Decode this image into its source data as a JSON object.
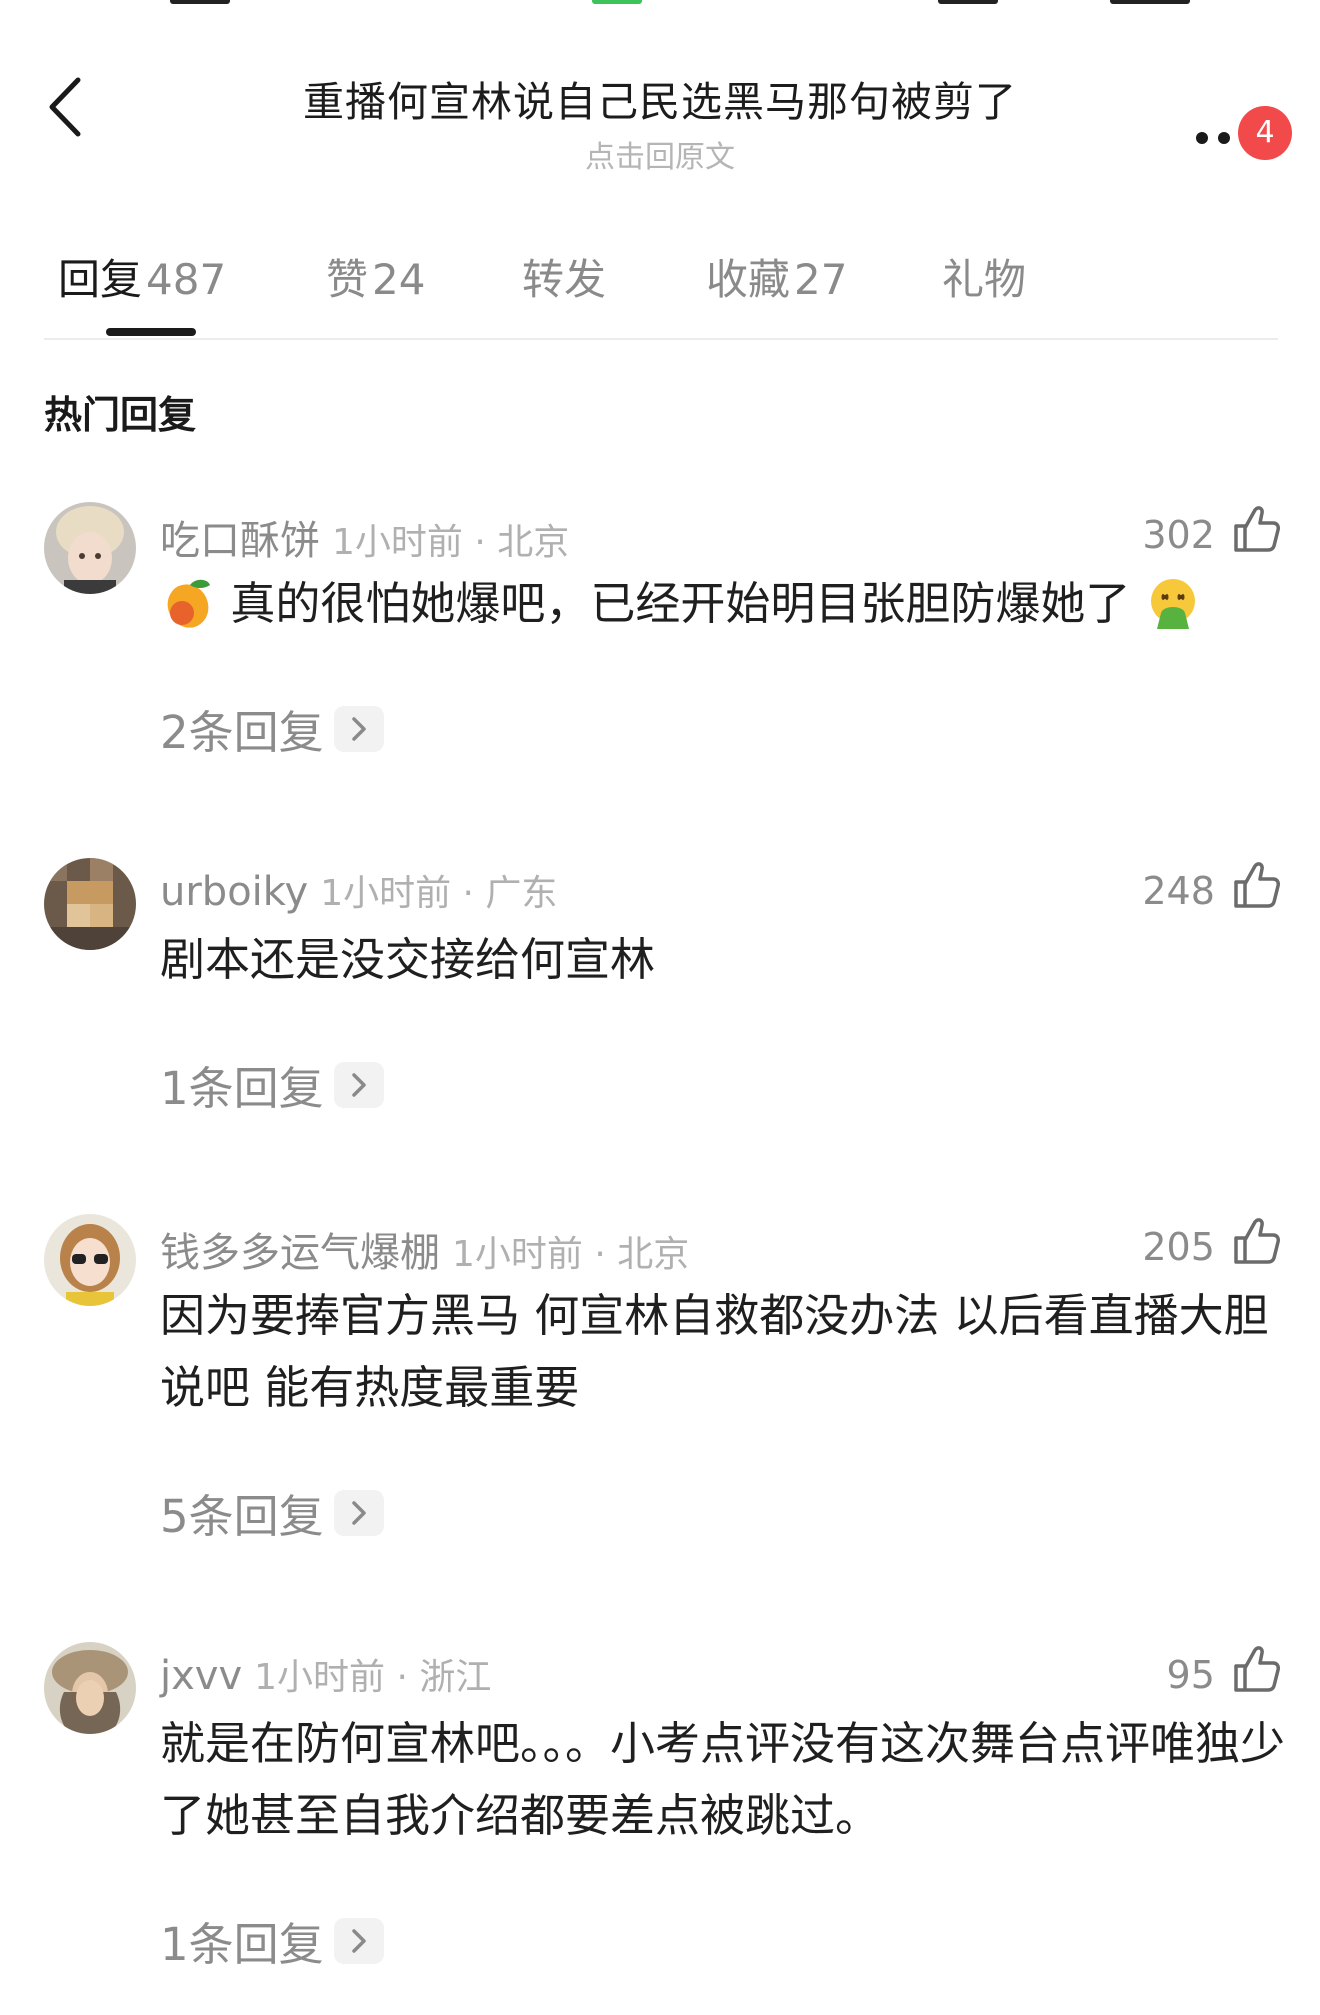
{
  "header": {
    "title": "重播何宣林说自己民选黑马那句被剪了",
    "subtitle": "点击回原文",
    "notification_count": "4"
  },
  "tabs": [
    {
      "label": "回复",
      "count": "487",
      "active": true
    },
    {
      "label": "赞",
      "count": "24",
      "active": false
    },
    {
      "label": "转发",
      "count": "",
      "active": false
    },
    {
      "label": "收藏",
      "count": "27",
      "active": false
    },
    {
      "label": "礼物",
      "count": "",
      "active": false
    }
  ],
  "section_title": "热门回复",
  "comments": [
    {
      "username": "吃口酥饼",
      "meta": "1小时前 · 北京",
      "likes": "302",
      "text": "真的很怕她爆吧，已经开始明目张胆防爆她了",
      "leading_emoji": "mango",
      "trailing_emoji": "face-vomiting",
      "replies_label": "2条回复"
    },
    {
      "username": "urboiky",
      "meta": "1小时前 · 广东",
      "likes": "248",
      "text": "剧本还是没交接给何宣林",
      "replies_label": "1条回复"
    },
    {
      "username": "钱多多运气爆棚",
      "meta": "1小时前 · 北京",
      "likes": "205",
      "text": "因为要捧官方黑马 何宣林自救都没办法 以后看直播大胆说吧 能有热度最重要",
      "replies_label": "5条回复"
    },
    {
      "username": "jxvv",
      "meta": "1小时前 · 浙江",
      "likes": "95",
      "text": "就是在防何宣林吧。。。小考点评没有这次舞台点评唯独少了她甚至自我介绍都要差点被跳过。",
      "replies_label": "1条回复"
    }
  ],
  "colors": {
    "badge": "#f2494b",
    "muted_text": "#8b8b8b",
    "light_text": "#b0b0b0",
    "primary_text": "#1a1a1a"
  }
}
